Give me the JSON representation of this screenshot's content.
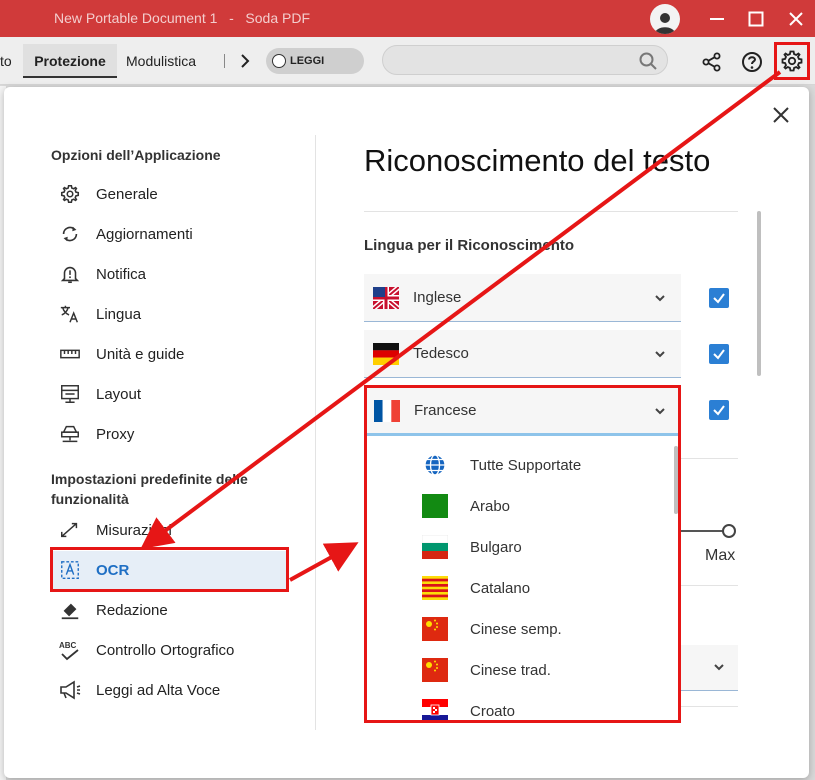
{
  "window": {
    "title": "New Portable Document 1   -   Soda PDF",
    "colors": {
      "titlebar": "#d03a3a",
      "accent": "#2b7fd4",
      "highlight": "#e61616"
    }
  },
  "ribbon": {
    "tab_partial": "to",
    "tabs": [
      {
        "label": "Protezione",
        "active": true
      },
      {
        "label": "Modulistica",
        "active": false
      }
    ],
    "read_toggle": "LEGGI",
    "search_placeholder": ""
  },
  "dialog": {
    "sidebar": {
      "section1": "Opzioni dell’Applicazione",
      "items1": [
        {
          "label": "Generale",
          "icon": "gear-icon"
        },
        {
          "label": "Aggiornamenti",
          "icon": "sync-icon"
        },
        {
          "label": "Notifica",
          "icon": "bell-icon"
        },
        {
          "label": "Lingua",
          "icon": "translate-icon"
        },
        {
          "label": "Unità e guide",
          "icon": "ruler-icon"
        },
        {
          "label": "Layout",
          "icon": "layout-icon"
        },
        {
          "label": "Proxy",
          "icon": "proxy-icon"
        }
      ],
      "section2_line1": "Impostazioni predefinite delle",
      "section2_line2": "funzionalità",
      "items2": [
        {
          "label": "Misurazioni",
          "icon": "measure-icon"
        },
        {
          "label": "OCR",
          "icon": "ocr-icon",
          "active": true
        },
        {
          "label": "Redazione",
          "icon": "eraser-icon"
        },
        {
          "label": "Controllo Ortografico",
          "icon": "spellcheck-icon"
        },
        {
          "label": "Leggi ad Alta Voce",
          "icon": "megaphone-icon"
        }
      ]
    },
    "main": {
      "title": "Riconoscimento del testo",
      "lang_heading": "Lingua per il Riconoscimento",
      "languages": [
        {
          "name": "Inglese",
          "checked": true,
          "flag": "uk-us-flag"
        },
        {
          "name": "Tedesco",
          "checked": true,
          "flag": "german-flag"
        },
        {
          "name": "Francese",
          "checked": true,
          "flag": "french-flag"
        }
      ],
      "max_label": "Max",
      "dropdown_options": [
        {
          "name": "Tutte Supportate",
          "flag": "globe"
        },
        {
          "name": "Arabo",
          "flag": "arabic"
        },
        {
          "name": "Bulgaro",
          "flag": "bulgarian"
        },
        {
          "name": "Catalano",
          "flag": "catalan"
        },
        {
          "name": "Cinese semp.",
          "flag": "chinese"
        },
        {
          "name": "Cinese trad.",
          "flag": "chinese"
        },
        {
          "name": "Croato",
          "flag": "croatian"
        }
      ]
    }
  }
}
